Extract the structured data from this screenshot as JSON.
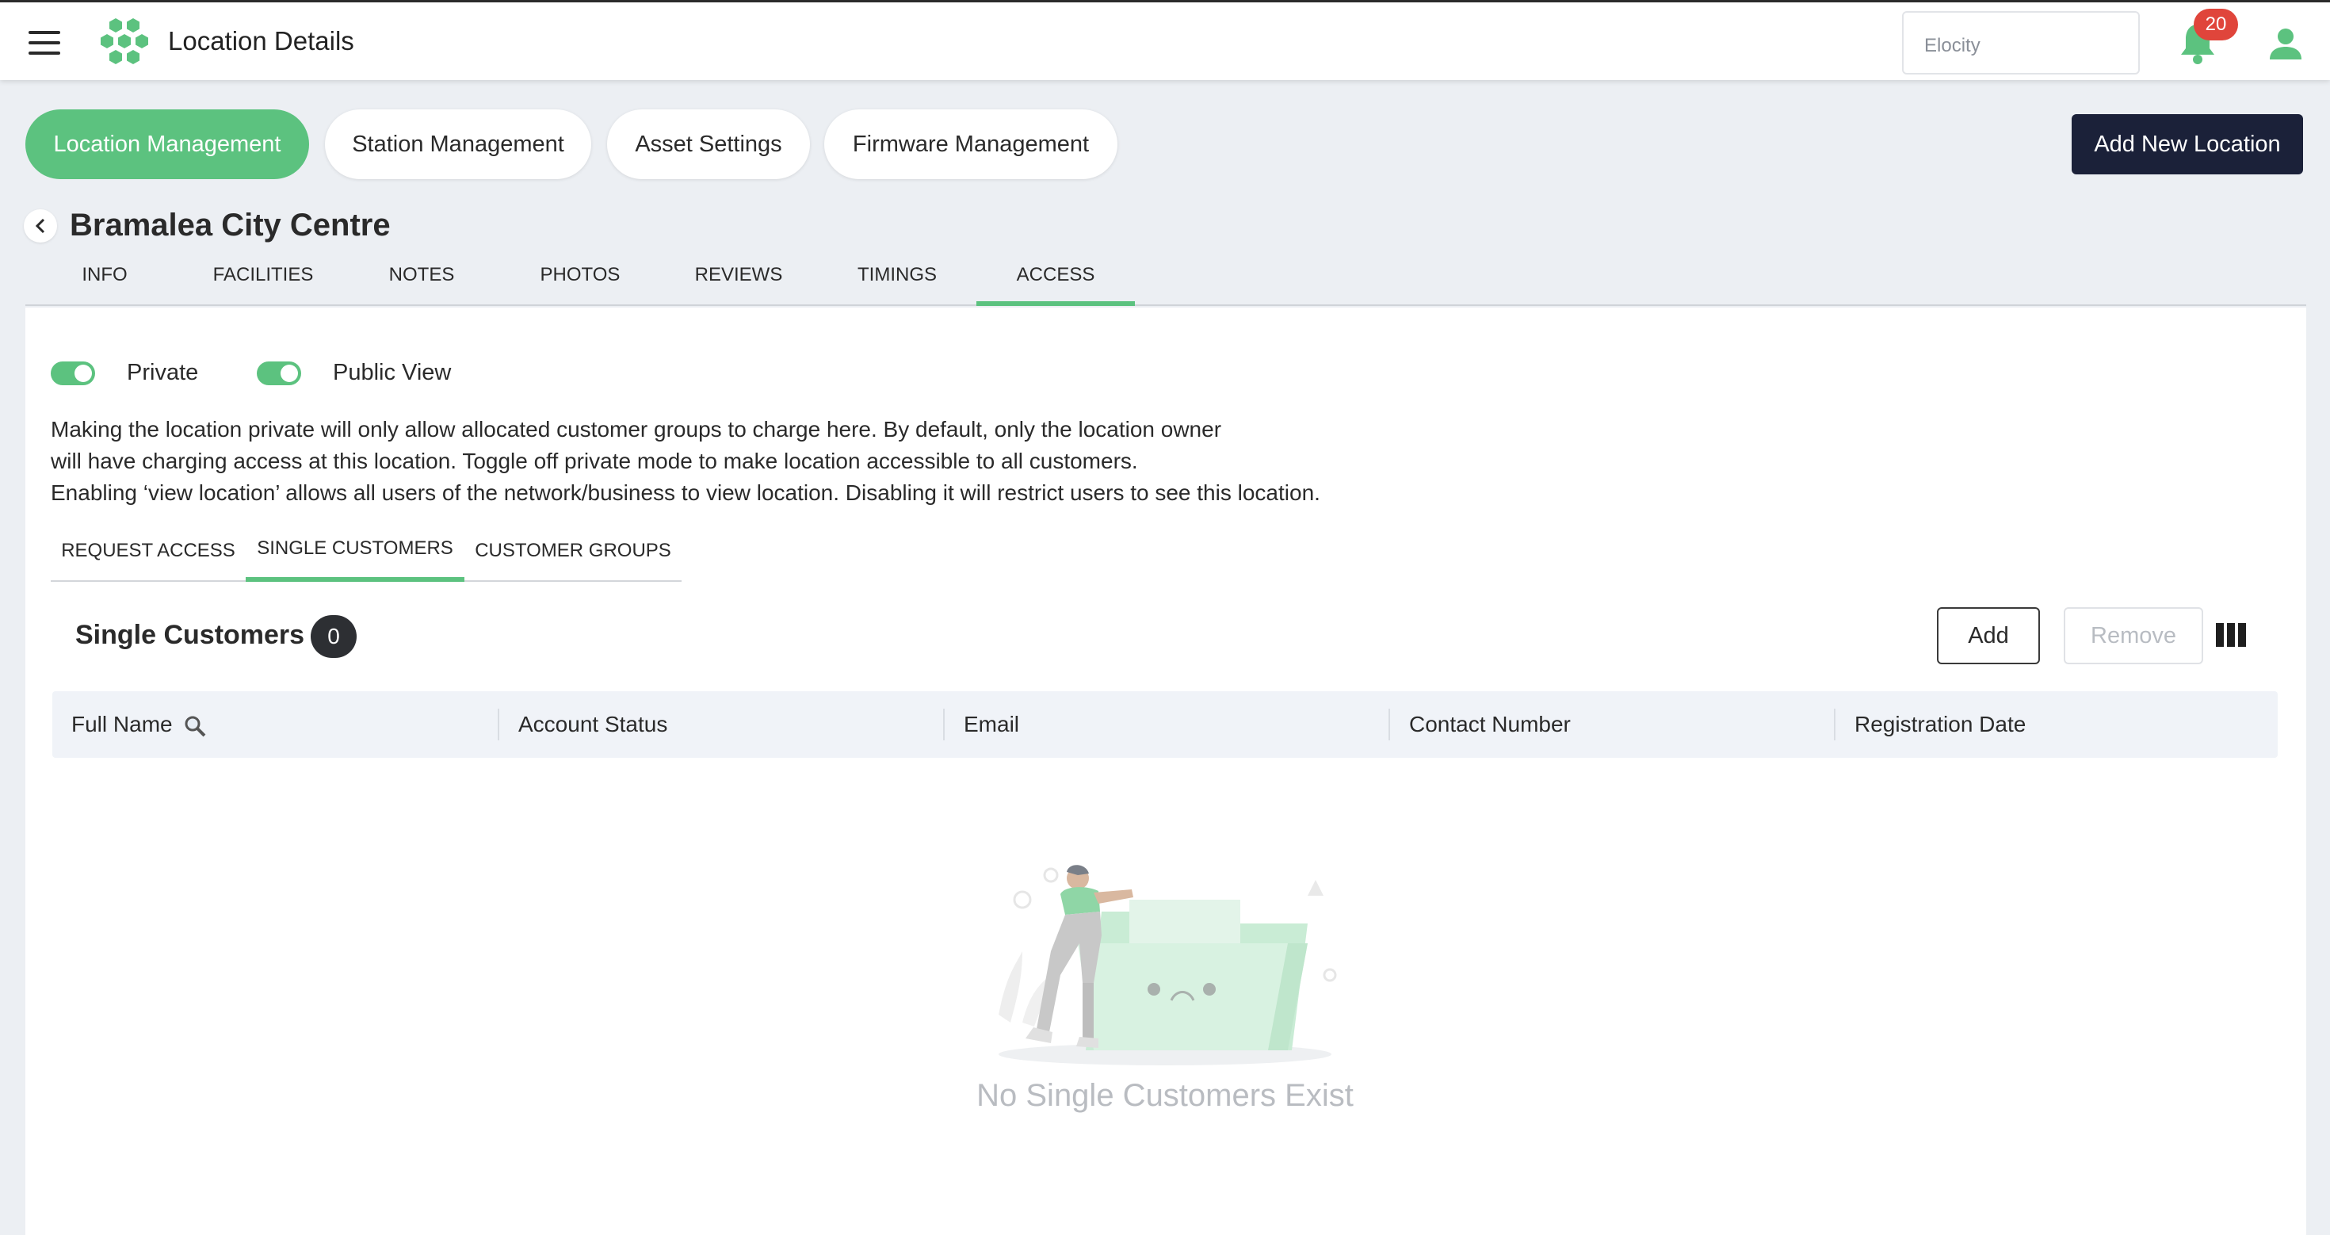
{
  "header": {
    "title": "Location Details",
    "org_selector": "Elocity",
    "notification_count": "20",
    "icons": [
      "menu-icon",
      "hexagon-logo-icon",
      "bell-icon",
      "user-icon"
    ]
  },
  "main_nav": {
    "items": [
      "Location Management",
      "Station Management",
      "Asset Settings",
      "Firmware Management"
    ],
    "active": "Location Management",
    "add_button": "Add New Location"
  },
  "location": {
    "name": "Bramalea City Centre"
  },
  "tabs": {
    "items": [
      "INFO",
      "FACILITIES",
      "NOTES",
      "PHOTOS",
      "REVIEWS",
      "TIMINGS",
      "ACCESS"
    ],
    "active": "ACCESS"
  },
  "access": {
    "private_label": "Private",
    "private_on": true,
    "public_view_label": "Public View",
    "public_view_on": true,
    "description": [
      "Making the location private will only allow allocated customer groups to charge here. By default, only the location owner",
      "will have charging access at this location. Toggle off private mode to make location accessible to all customers.",
      "Enabling ‘view location’ allows all users of the network/business to view location. Disabling it will restrict users to see this location."
    ]
  },
  "subtabs": {
    "items": [
      "REQUEST ACCESS",
      "SINGLE CUSTOMERS",
      "CUSTOMER GROUPS"
    ],
    "active": "SINGLE CUSTOMERS"
  },
  "single_customers": {
    "title": "Single Customers",
    "count": "0",
    "add_button": "Add",
    "remove_button": "Remove",
    "columns": [
      "Full Name",
      "Account Status",
      "Email",
      "Contact Number",
      "Registration Date"
    ],
    "rows": [],
    "empty_message": "No Single Customers Exist"
  },
  "colors": {
    "accent": "#5cc27f",
    "dark_button": "#1b2139",
    "badge_red": "#e0453b"
  }
}
